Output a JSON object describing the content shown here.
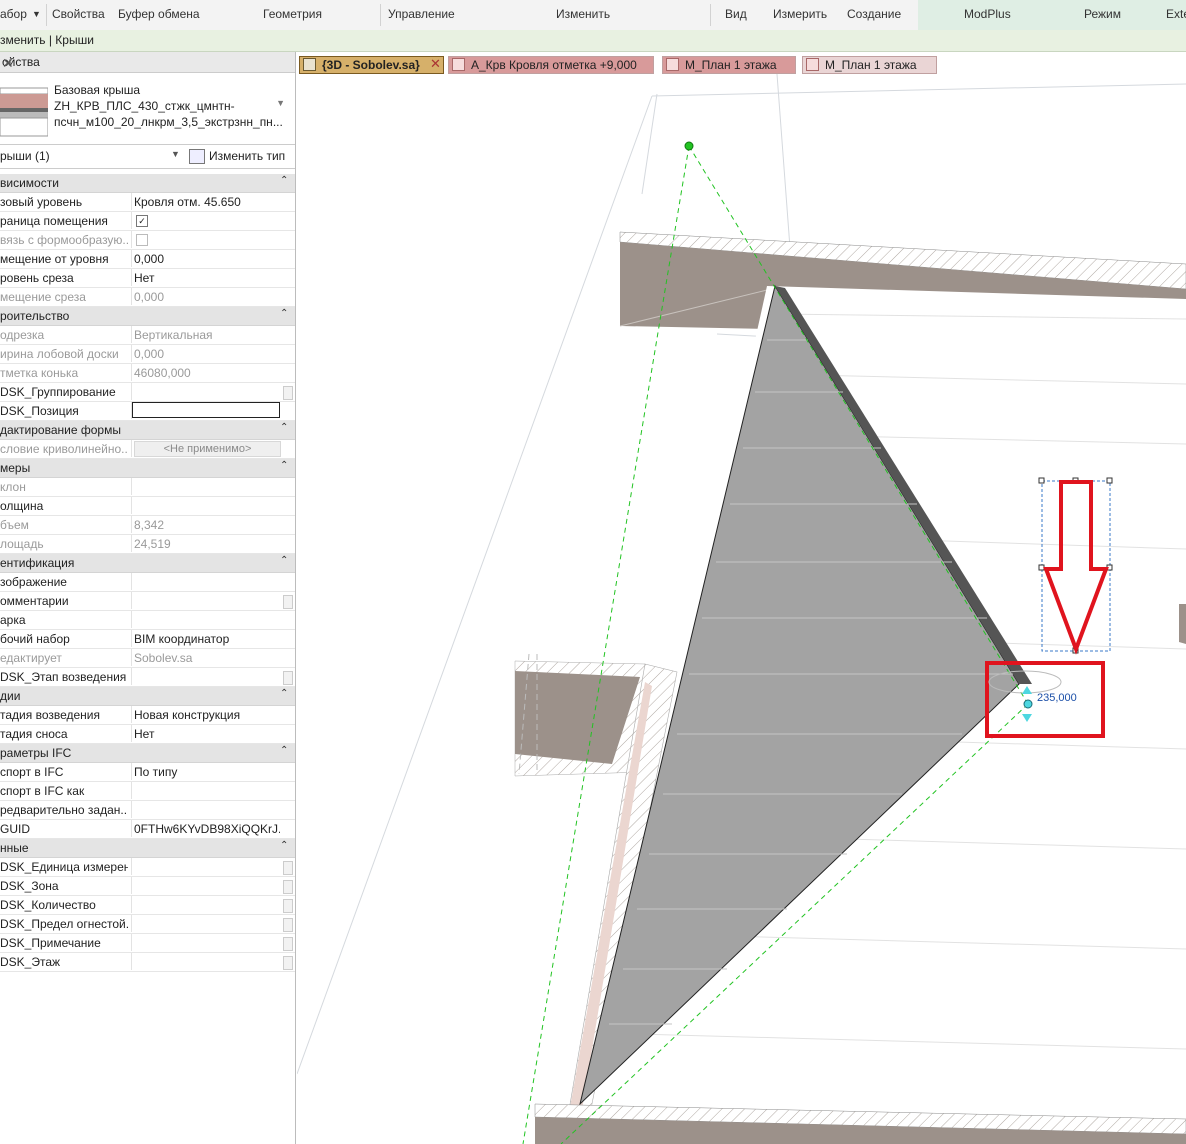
{
  "ribbon": {
    "left_cut": "абор",
    "groups": [
      "Свойства",
      "Буфер обмена",
      "Геометрия",
      "Управление",
      "Изменить",
      "Вид",
      "Измерить",
      "Создание",
      "ModPlus",
      "Режим",
      "Exte"
    ]
  },
  "context_bar": {
    "text": "зменить | Крыши"
  },
  "properties": {
    "title": "ойства",
    "type_name_line1": "Базовая крыша",
    "type_name_line2": "ZH_КРВ_ПЛС_430_стжк_цмнтн-",
    "type_name_line3": "псчн_м100_20_лнкрм_3,5_экстрзнн_пн...",
    "filter": "рыши (1)",
    "edit_type": "Изменить тип",
    "rows": [
      {
        "kind": "group",
        "name": "висимости"
      },
      {
        "kind": "row",
        "name": "зовый уровень",
        "value": "Кровля отм. 45.650"
      },
      {
        "kind": "row",
        "name": "раница помещения",
        "check": "on"
      },
      {
        "kind": "row",
        "name": "вязь с формообразую...",
        "check": "off",
        "dis": true
      },
      {
        "kind": "row",
        "name": "мещение от уровня",
        "value": "0,000"
      },
      {
        "kind": "row",
        "name": "ровень среза",
        "value": "Нет"
      },
      {
        "kind": "row",
        "name": "мещение среза",
        "value": "0,000",
        "dis": true
      },
      {
        "kind": "group",
        "name": "роительство"
      },
      {
        "kind": "row",
        "name": "одрезка",
        "value": "Вертикальная",
        "dis": true
      },
      {
        "kind": "row",
        "name": "ирина лобовой доски",
        "value": "0,000",
        "dis": true
      },
      {
        "kind": "row",
        "name": "тметка конька",
        "value": "46080,000",
        "dis": true
      },
      {
        "kind": "row",
        "name": "DSK_Группирование",
        "value": "",
        "sc": true
      },
      {
        "kind": "row",
        "name": "DSK_Позиция",
        "input": true
      },
      {
        "kind": "group",
        "name": "дактирование формы"
      },
      {
        "kind": "row",
        "name": "словие криволинейно...",
        "na": "<Не применимо>",
        "dis": true
      },
      {
        "kind": "group",
        "name": "меры"
      },
      {
        "kind": "row",
        "name": "клон",
        "value": "",
        "dis": true
      },
      {
        "kind": "row",
        "name": "олщина",
        "value": ""
      },
      {
        "kind": "row",
        "name": "бъем",
        "value": "8,342",
        "dis": true
      },
      {
        "kind": "row",
        "name": "лощадь",
        "value": "24,519",
        "dis": true
      },
      {
        "kind": "group",
        "name": "ентификация"
      },
      {
        "kind": "row",
        "name": "зображение",
        "value": ""
      },
      {
        "kind": "row",
        "name": "омментарии",
        "value": "",
        "sc": true
      },
      {
        "kind": "row",
        "name": "арка",
        "value": ""
      },
      {
        "kind": "row",
        "name": "бочий набор",
        "value": "BIM координатор"
      },
      {
        "kind": "row",
        "name": "едактирует",
        "value": "Sobolev.sa",
        "dis": true
      },
      {
        "kind": "row",
        "name": "DSK_Этап возведения",
        "value": "",
        "sc": true
      },
      {
        "kind": "group",
        "name": "дии"
      },
      {
        "kind": "row",
        "name": "тадия возведения",
        "value": "Новая конструкция"
      },
      {
        "kind": "row",
        "name": "тадия сноса",
        "value": "Нет"
      },
      {
        "kind": "group",
        "name": "раметры IFC"
      },
      {
        "kind": "row",
        "name": "спорт в IFC",
        "value": "По типу"
      },
      {
        "kind": "row",
        "name": "спорт в IFC как",
        "value": ""
      },
      {
        "kind": "row",
        "name": "редварительно задан...",
        "value": ""
      },
      {
        "kind": "row",
        "name": "GUID",
        "value": "0FTHw6KYvDB98XiQQKrJ..."
      },
      {
        "kind": "group",
        "name": "нные"
      },
      {
        "kind": "row",
        "name": "DSK_Единица измерен...",
        "value": "",
        "sc": true
      },
      {
        "kind": "row",
        "name": "DSK_Зона",
        "value": "",
        "sc": true
      },
      {
        "kind": "row",
        "name": "DSK_Количество",
        "value": "",
        "sc": true
      },
      {
        "kind": "row",
        "name": "DSK_Предел огнестой...",
        "value": "",
        "sc": true
      },
      {
        "kind": "row",
        "name": "DSK_Примечание",
        "value": "",
        "sc": true
      },
      {
        "kind": "row",
        "name": "DSK_Этаж",
        "value": "",
        "sc": true
      }
    ]
  },
  "tabs": [
    {
      "label": "{3D - Sobolev.sa}",
      "active": true
    },
    {
      "label": "А_Крв Кровля отметка +9,000"
    },
    {
      "label": "М_План 1 этажа"
    },
    {
      "label": "М_План 1 этажа"
    }
  ],
  "viewport": {
    "dimension": "235,000"
  },
  "colors": {
    "annotation": "#e0141e",
    "accent_active_tab": "#d6b06a",
    "roof_fill": "#a3a3a3",
    "wall_fill": "#9c918a"
  }
}
